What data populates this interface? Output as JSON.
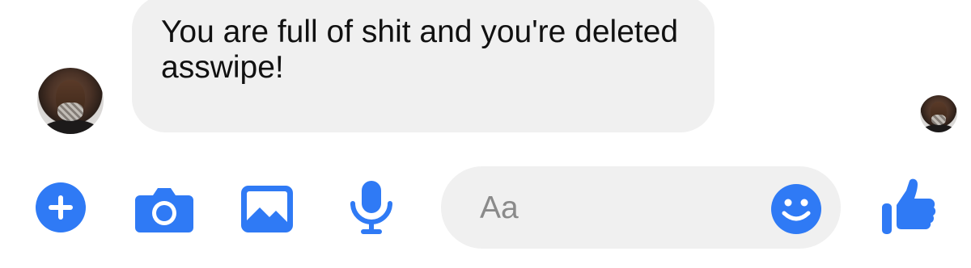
{
  "conversation": {
    "messages": [
      {
        "sender": "other",
        "text": "You are full of shit and you're deleted asswipe!"
      }
    ]
  },
  "composer": {
    "placeholder": "Aa",
    "icons": {
      "plus": "plus-circle-icon",
      "camera": "camera-icon",
      "picture": "image-icon",
      "mic": "microphone-icon",
      "emoji": "emoji-smile-icon",
      "like": "thumbs-up-icon"
    },
    "accent_color": "#2f7af5",
    "bubble_color": "#f0f0f0"
  }
}
